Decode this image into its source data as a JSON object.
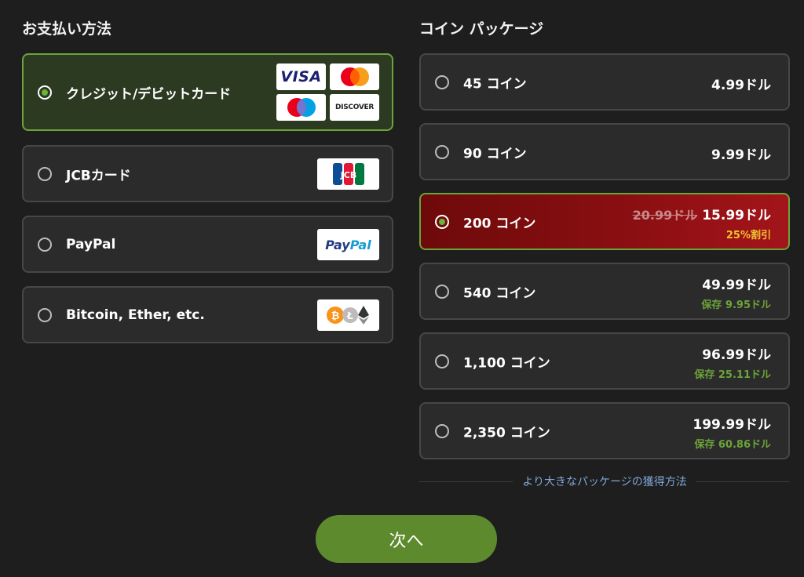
{
  "payment": {
    "title": "お支払い方法",
    "methods": [
      {
        "label": "クレジット/デビットカード",
        "selected": true
      },
      {
        "label": "JCBカード",
        "selected": false
      },
      {
        "label": "PayPal",
        "selected": false
      },
      {
        "label": "Bitcoin, Ether, etc.",
        "selected": false
      }
    ],
    "logos": {
      "visa": "VISA",
      "discover": "DISCOVER",
      "jcb": "JCB",
      "paypal_pay": "Pay",
      "paypal_pal": "Pal"
    }
  },
  "packages": {
    "title": "コイン パッケージ",
    "items": [
      {
        "label": "45 コイン",
        "price": "4.99ドル",
        "selected": false
      },
      {
        "label": "90 コイン",
        "price": "9.99ドル",
        "selected": false
      },
      {
        "label": "200 コイン",
        "old_price": "20.99ドル",
        "price": "15.99ドル",
        "discount": "25%割引",
        "selected": true
      },
      {
        "label": "540 コイン",
        "price": "49.99ドル",
        "save": "保存 9.95ドル",
        "selected": false
      },
      {
        "label": "1,100 コイン",
        "price": "96.99ドル",
        "save": "保存 25.11ドル",
        "selected": false
      },
      {
        "label": "2,350 コイン",
        "price": "199.99ドル",
        "save": "保存 60.86ドル",
        "selected": false
      }
    ],
    "bigger_link": "より大きなパッケージの獲得方法"
  },
  "next_button": "次へ",
  "colors": {
    "accent_green": "#6ca33a",
    "button_green": "#5e8a2e",
    "selected_red": "#8c0f12",
    "discount_yellow": "#f2c230",
    "link_blue": "#7fa6d6"
  }
}
